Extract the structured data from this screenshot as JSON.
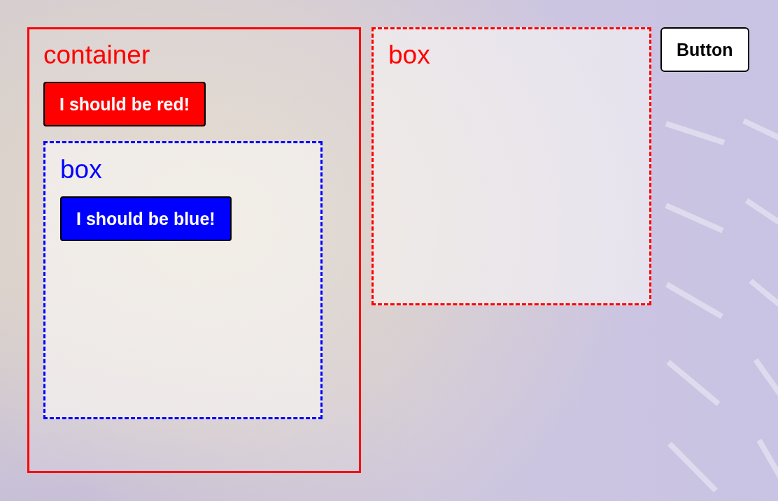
{
  "panels": [
    {
      "kind": "solid",
      "label": "container",
      "color": "#ff0000",
      "button": {
        "label": "I should be red!"
      },
      "children": [
        {
          "kind": "dashed",
          "label": "box",
          "color": "#0000ff",
          "button": {
            "label": "I should be blue!"
          }
        }
      ]
    },
    {
      "kind": "dashed",
      "label": "box",
      "color": "#ff0000"
    }
  ],
  "button": {
    "label": "Button"
  }
}
